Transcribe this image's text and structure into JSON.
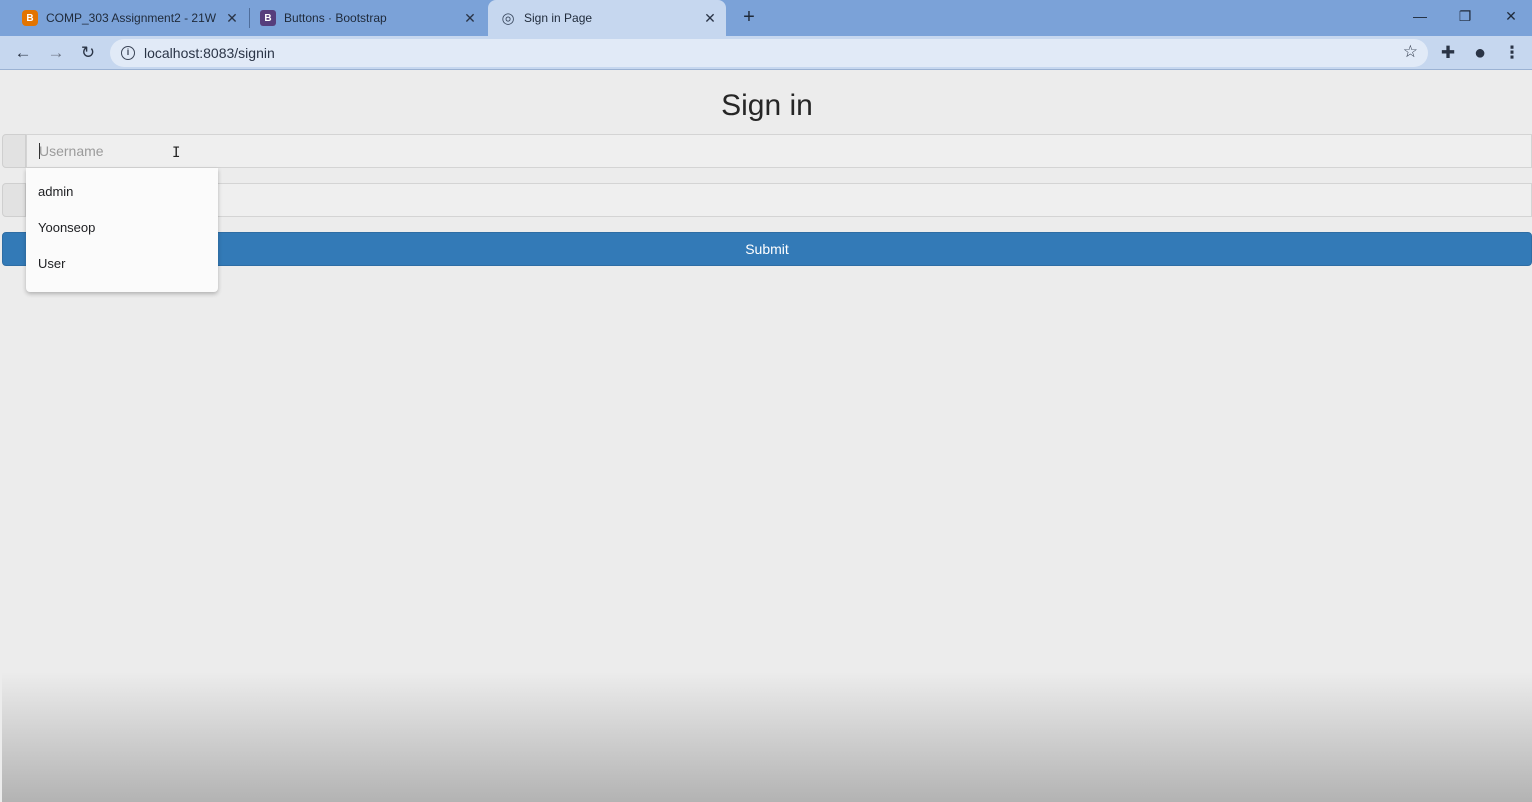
{
  "browser": {
    "tabs": [
      {
        "title": "COMP_303 Assignment2 - 21W",
        "favicon": "blogger-icon",
        "favicon_color": "#e37400",
        "favicon_glyph": "B"
      },
      {
        "title": "Buttons · Bootstrap",
        "favicon": "bootstrap-icon",
        "favicon_color": "#563d7c",
        "favicon_glyph": "B"
      },
      {
        "title": "Sign in Page",
        "favicon": "globe-icon",
        "favicon_color": "#3b4a60",
        "favicon_glyph": "◎",
        "active": true
      }
    ],
    "address": "localhost:8083/signin",
    "tabbar_color": "#7ba2d8",
    "toolbar_color": "#c6d7ef"
  },
  "page": {
    "heading": "Sign in",
    "username": {
      "placeholder": "Username",
      "value": ""
    },
    "password": {
      "placeholder": "",
      "value": ""
    },
    "submit_label": "Submit",
    "submit_color": "#337ab7",
    "autocomplete": [
      "admin",
      "Yoonseop",
      "User"
    ]
  }
}
